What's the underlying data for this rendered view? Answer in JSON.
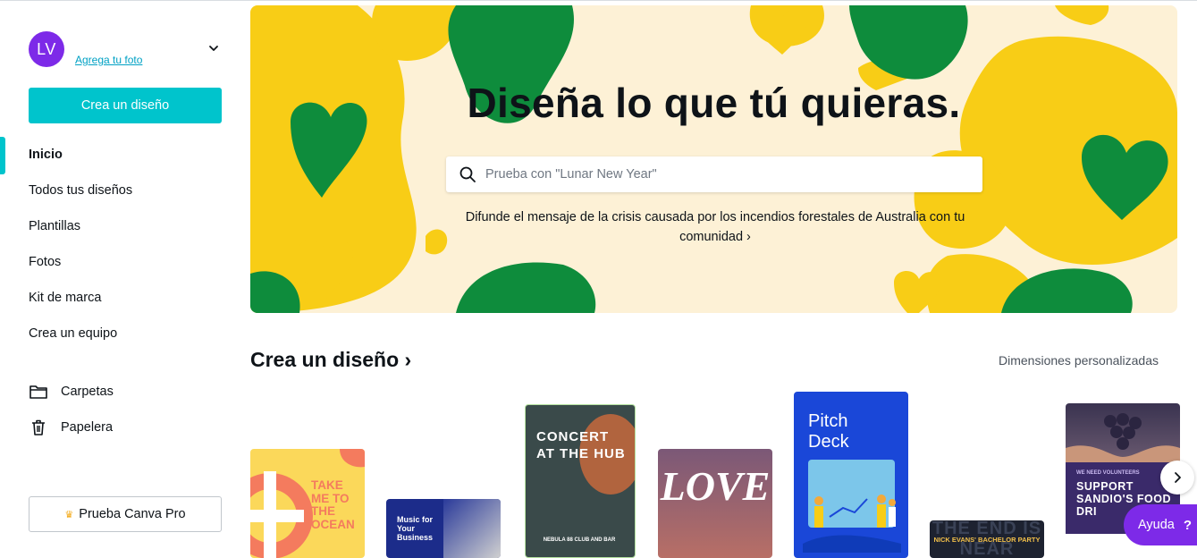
{
  "user": {
    "initials": "LV",
    "add_photo": "Agrega tu foto"
  },
  "sidebar": {
    "create_button": "Crea un diseño",
    "items": [
      {
        "label": "Inicio"
      },
      {
        "label": "Todos tus diseños"
      },
      {
        "label": "Plantillas"
      },
      {
        "label": "Fotos"
      },
      {
        "label": "Kit de marca"
      },
      {
        "label": "Crea un equipo"
      }
    ],
    "folders": {
      "label": "Carpetas",
      "icon": "folder-icon"
    },
    "trash": {
      "label": "Papelera",
      "icon": "trash-icon"
    },
    "pro_button": "Prueba Canva Pro"
  },
  "hero": {
    "title": "Diseña lo que tú quieras.",
    "search_placeholder": "Prueba con \"Lunar New Year\"",
    "message_line1": "Difunde el mensaje de la crisis causada por los incendios forestales de Australia con tu",
    "message_line2": "comunidad ›"
  },
  "section": {
    "title": "Crea un diseño ›",
    "custom_dimensions": "Dimensiones personalizadas"
  },
  "cards": {
    "ocean": "TAKE ME TO THE OCEAN",
    "music": "Music for Your Business",
    "concert_top": "CONCERT AT THE HUB",
    "concert_bottom": "NEBULA 88 CLUB AND BAR",
    "love": "LOVE",
    "pitch": "Pitch Deck",
    "end_party": "NICK EVANS' BACHELOR PARTY",
    "end_bg": "THE END IS NEAR",
    "food_label": "WE NEED VOLUNTEERS",
    "food_title": "SUPPORT SANDIO'S FOOD DRI"
  },
  "help": {
    "label": "Ayuda",
    "q": "?"
  },
  "colors": {
    "accent": "#00c4cc",
    "purple": "#7d2ae8",
    "hero_bg": "#fdf1d6",
    "yellow": "#f8cd16",
    "green": "#0e8c3c"
  }
}
